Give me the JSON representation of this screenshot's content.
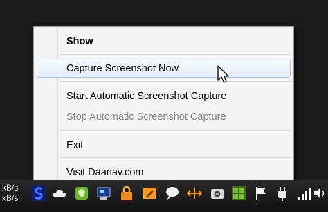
{
  "menu": {
    "show": "Show",
    "capture_now": "Capture Screenshot Now",
    "start_auto": "Start Automatic Screenshot Capture",
    "stop_auto": "Stop Automatic Screenshot Capture",
    "exit": "Exit",
    "visit": "Visit Daanav.com"
  },
  "taskbar": {
    "net_up": "kB/s",
    "net_down": "kB/s",
    "tray_icons": [
      "s-app-icon",
      "cloud-icon",
      "shield-icon",
      "network-icon",
      "lock-icon",
      "pencil-icon",
      "chat-bubble-icon",
      "arrows-icon",
      "camera-icon",
      "green-grid-icon",
      "flag-icon",
      "plug-icon",
      "signal-bars-icon",
      "volume-icon"
    ]
  },
  "colors": {
    "menu_bg": "#f3f3f3",
    "hover_border": "#a9c4ea",
    "disabled_text": "#8d8d8d"
  }
}
